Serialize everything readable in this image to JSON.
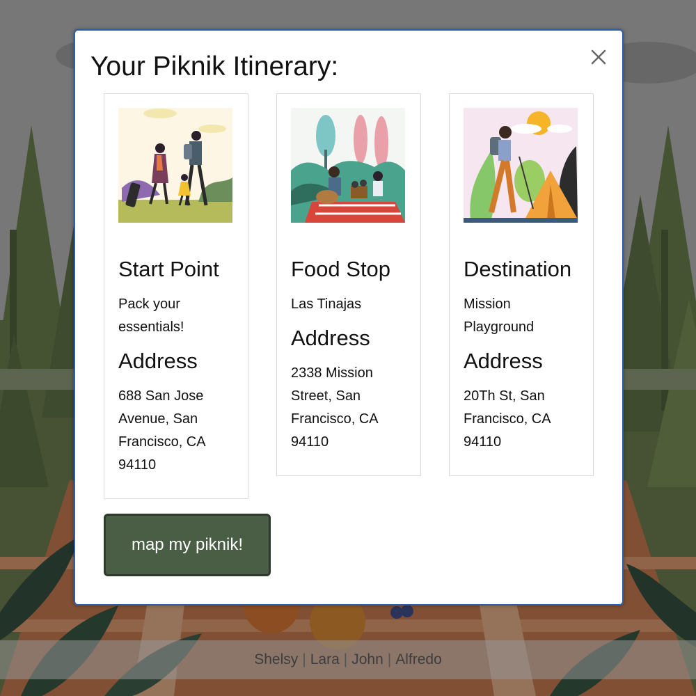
{
  "modal": {
    "title": "Your Piknik Itinerary:",
    "close_icon": "close-icon",
    "cards": [
      {
        "heading": "Start Point",
        "description": "Pack your essentials!",
        "address_heading": "Address",
        "address": "688 San Jose Avenue, San Francisco, CA 94110",
        "image": "family-walking-illustration"
      },
      {
        "heading": "Food Stop",
        "description": "Las Tinajas",
        "address_heading": "Address",
        "address": "2338 Mission Street, San Francisco, CA 94110",
        "image": "picnic-guitar-illustration"
      },
      {
        "heading": "Destination",
        "description": "Mission Playground",
        "address_heading": "Address",
        "address": "20Th St, San Francisco, CA 94110",
        "image": "hiker-tent-illustration"
      }
    ],
    "map_button": "map my piknik!"
  },
  "footer": {
    "names": [
      "Shelsy",
      "Lara",
      "John",
      "Alfredo"
    ]
  },
  "colors": {
    "modal_border": "#2c5fa8",
    "button_bg": "#4a5d45",
    "button_border": "#2e3a2c",
    "footer_bg": "#969696",
    "pine": "#5a6e3a",
    "blanket": "#c46a3c"
  }
}
